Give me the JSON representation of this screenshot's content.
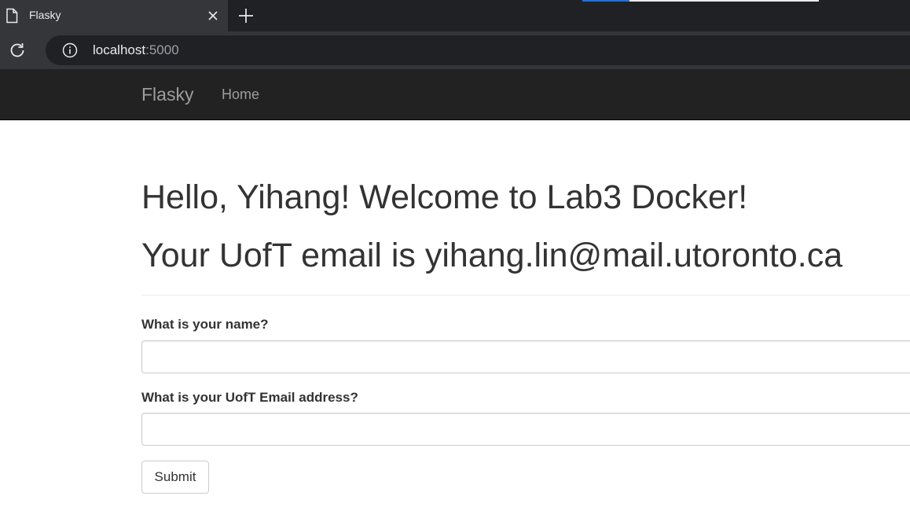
{
  "browser": {
    "tab_title": "Flasky",
    "url_host": "localhost",
    "url_port": ":5000",
    "icons": {
      "favicon": "page-icon",
      "close": "close-icon",
      "new_tab": "plus-icon",
      "reload": "reload-icon",
      "site_info": "info-icon"
    },
    "colors": {
      "tabstrip": "#202124",
      "active_tab": "#35363a",
      "omnibox": "#202124",
      "progress_blue": "#1a73e8"
    }
  },
  "navbar": {
    "brand": "Flasky",
    "links": [
      {
        "label": "Home"
      }
    ],
    "colors": {
      "background": "#222222",
      "text": "#9d9d9d"
    }
  },
  "main": {
    "greeting": "Hello, Yihang! Welcome to Lab3 Docker!",
    "email_line": "Your UofT email is yihang.lin@mail.utoronto.ca",
    "form": {
      "name_label": "What is your name?",
      "name_value": "",
      "email_label": "What is your UofT Email address?",
      "email_value": "",
      "submit_label": "Submit"
    }
  }
}
